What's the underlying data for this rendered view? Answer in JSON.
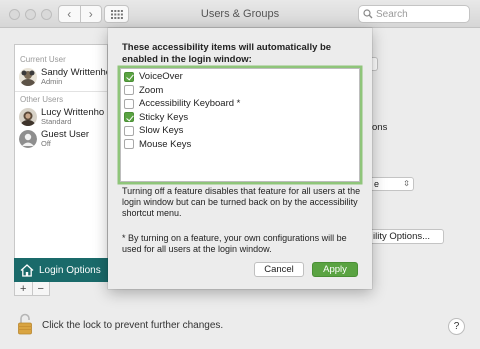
{
  "window": {
    "title": "Users & Groups",
    "search_placeholder": "Search"
  },
  "users": {
    "current_label": "Current User",
    "current": [
      {
        "name": "Sandy Writtenho",
        "role": "Admin"
      }
    ],
    "other_label": "Other Users",
    "others": [
      {
        "name": "Lucy Writtenho",
        "role": "Standard"
      },
      {
        "name": "Guest User",
        "role": "Off"
      }
    ],
    "login_options_label": "Login Options"
  },
  "background": {
    "fragment_ons": "ons",
    "select_value": "e",
    "options_button": "ility Options..."
  },
  "sheet": {
    "intro": "These accessibility items will automatically be enabled in the login window:",
    "items": [
      {
        "label": "VoiceOver",
        "checked": true
      },
      {
        "label": "Zoom",
        "checked": false
      },
      {
        "label": "Accessibility Keyboard *",
        "checked": false
      },
      {
        "label": "Sticky Keys",
        "checked": true
      },
      {
        "label": "Slow Keys",
        "checked": false
      },
      {
        "label": "Mouse Keys",
        "checked": false
      }
    ],
    "note1": "Turning off a feature disables that feature for all users at the login window but can be turned back on by the accessibility shortcut menu.",
    "note2": "* By turning on a feature, your own configurations will be used for all users at the login window.",
    "cancel_label": "Cancel",
    "apply_label": "Apply"
  },
  "footer": {
    "lock_text": "Click the lock to prevent further changes.",
    "help_label": "?"
  },
  "colors": {
    "accent_green": "#5aa342",
    "login_options_bg": "#1a6a6a"
  }
}
